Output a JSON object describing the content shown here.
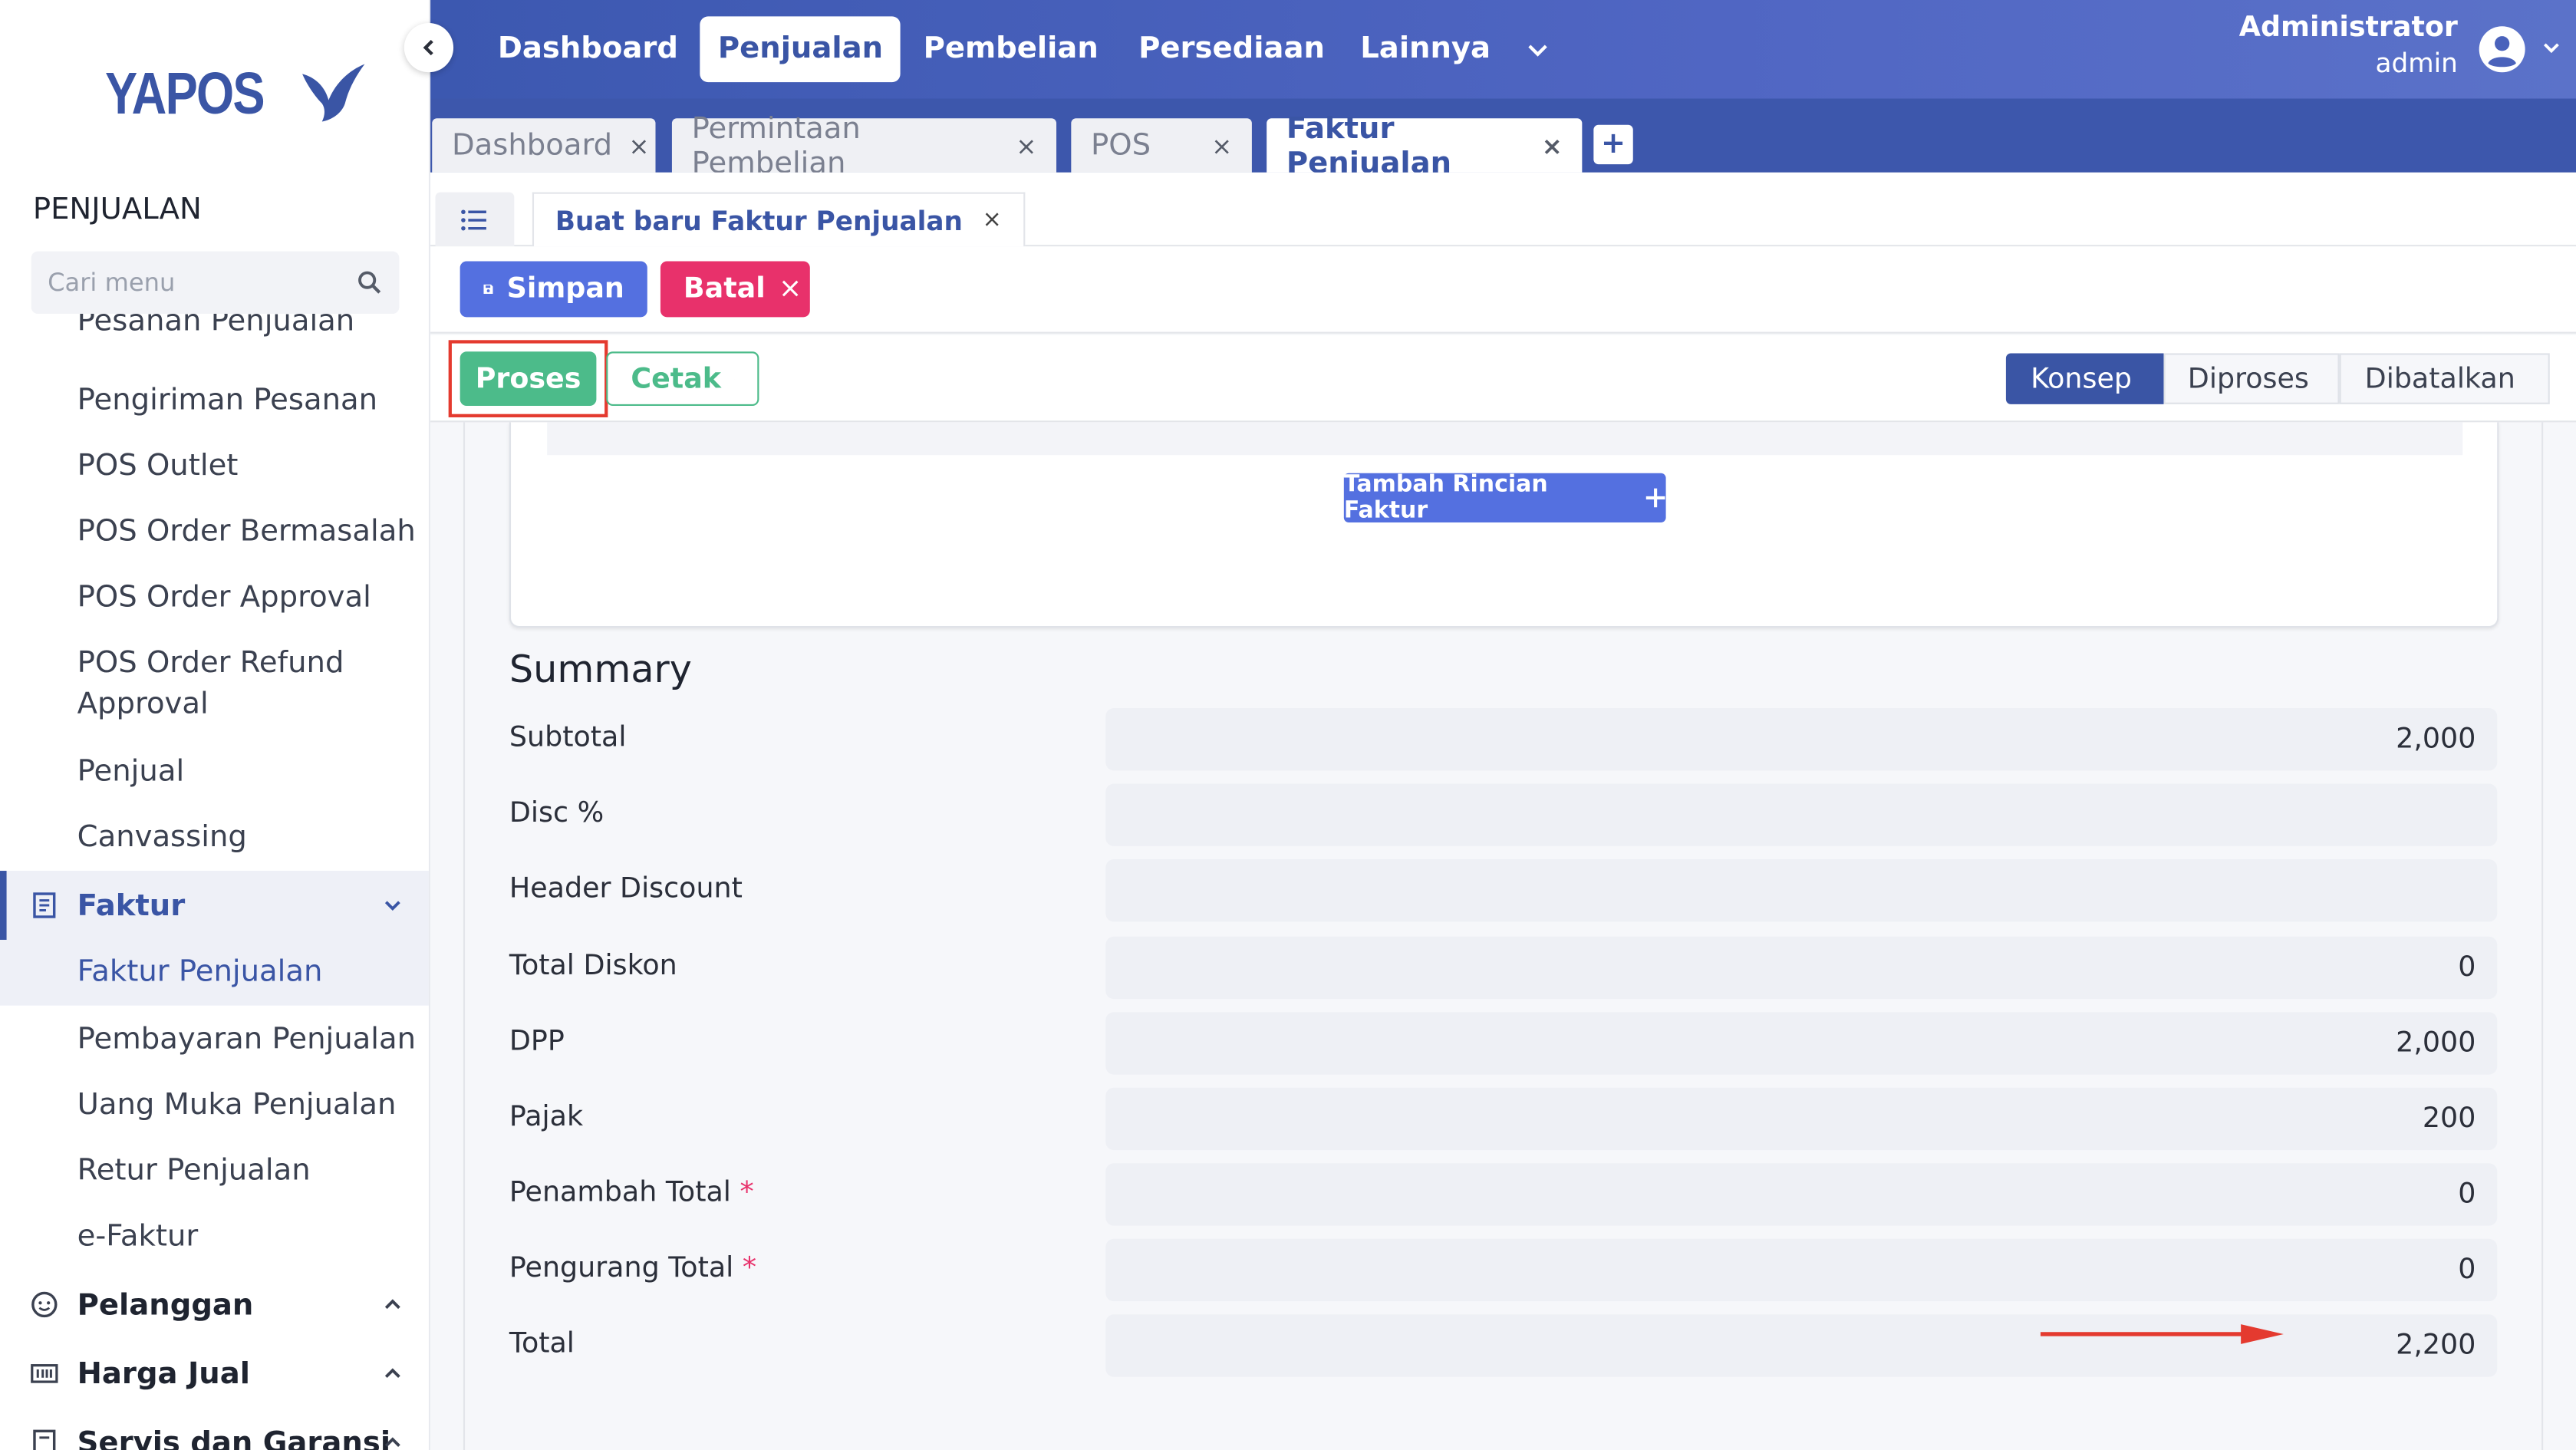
{
  "brand": {
    "name": "YAPOS"
  },
  "sidebar": {
    "section_title": "PENJUALAN",
    "search_placeholder": "Cari menu",
    "items_top": [
      "Pesanan Penjualan",
      "Pengiriman Pesanan",
      "POS Outlet",
      "POS Order Bermasalah",
      "POS Order Approval",
      "POS Order Refund Approval",
      "Penjual",
      "Canvassing"
    ],
    "group_faktur": "Faktur",
    "faktur_items": [
      "Faktur Penjualan",
      "Pembayaran Penjualan",
      "Uang Muka Penjualan",
      "Retur Penjualan",
      "e-Faktur"
    ],
    "group_pelanggan": "Pelanggan",
    "group_harga": "Harga Jual",
    "group_servis": "Servis dan Garansi"
  },
  "topnav": {
    "items": [
      "Dashboard",
      "Penjualan",
      "Pembelian",
      "Persediaan",
      "Lainnya"
    ],
    "active": "Penjualan"
  },
  "user": {
    "name": "Administrator",
    "role": "admin"
  },
  "open_tabs": [
    {
      "label": "Dashboard",
      "close": "×"
    },
    {
      "label": "Permintaan Pembelian",
      "close": "×"
    },
    {
      "label": "POS",
      "close": "×"
    },
    {
      "label": "Faktur Penjualan",
      "close": "×"
    }
  ],
  "add_tab": "+",
  "subtab": {
    "label": "Buat baru Faktur Penjualan",
    "close": "×"
  },
  "actions": {
    "save": "Simpan",
    "cancel": "Batal",
    "cancel_x": "×",
    "process": "Proses",
    "print": "Cetak"
  },
  "status_steps": [
    "Konsep",
    "Diproses",
    "Dibatalkan"
  ],
  "active_step": "Konsep",
  "add_detail_button": "Tambah Rincian Faktur",
  "summary": {
    "title": "Summary",
    "rows": [
      {
        "label": "Subtotal",
        "value": "2,000",
        "required": false
      },
      {
        "label": "Disc %",
        "value": "",
        "required": false
      },
      {
        "label": "Header Discount",
        "value": "",
        "required": false
      },
      {
        "label": "Total Diskon",
        "value": "0",
        "required": false
      },
      {
        "label": "DPP",
        "value": "2,000",
        "required": false
      },
      {
        "label": "Pajak",
        "value": "200",
        "required": false
      },
      {
        "label": "Penambah Total",
        "value": "0",
        "required": true
      },
      {
        "label": "Pengurang Total",
        "value": "0",
        "required": true
      },
      {
        "label": "Total",
        "value": "2,200",
        "required": false
      }
    ],
    "required_mark": "*"
  },
  "colors": {
    "primary": "#3a55a5",
    "save": "#5470e0",
    "cancel": "#e8316b",
    "process": "#4cbb8a",
    "annotation": "#e43a2f"
  }
}
